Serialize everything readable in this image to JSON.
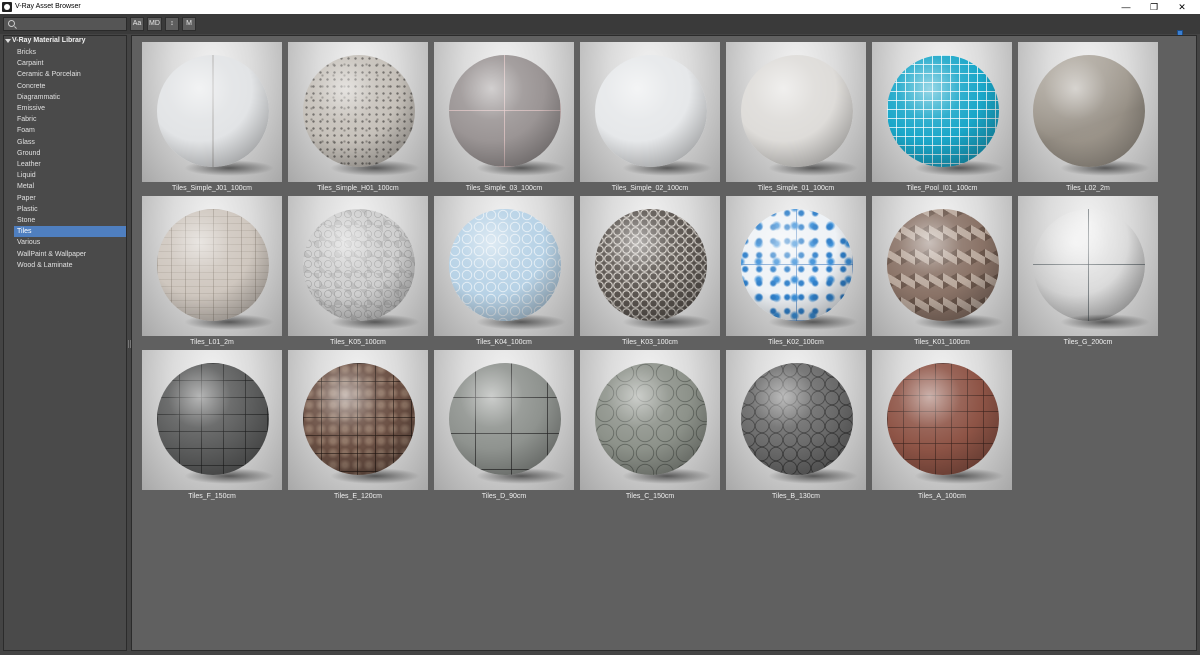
{
  "window": {
    "title": "V-Ray Asset Browser",
    "minimize_glyph": "—",
    "maximize_glyph": "❐",
    "close_glyph": "✕"
  },
  "toolbar": {
    "search_placeholder": "",
    "buttons": {
      "aa": "Aa",
      "md": "MD",
      "sort": "↕",
      "m": "M"
    },
    "thumbnail_size_level": 0.8
  },
  "sidebar": {
    "root": "V-Ray Material Library",
    "items": [
      "Bricks",
      "Carpaint",
      "Ceramic & Porcelain",
      "Concrete",
      "Diagrammatic",
      "Emissive",
      "Fabric",
      "Foam",
      "Glass",
      "Ground",
      "Leather",
      "Liquid",
      "Metal",
      "Paper",
      "Plastic",
      "Stone",
      "Tiles",
      "Various",
      "WallPaint & Wallpaper",
      "Wood & Laminate"
    ],
    "selected": "Tiles"
  },
  "materials": [
    {
      "name": "Tiles_Simple_J01_100cm",
      "icon": "m-split"
    },
    {
      "name": "Tiles_Simple_H01_100cm",
      "icon": "m-terrazzo"
    },
    {
      "name": "Tiles_Simple_03_100cm",
      "icon": "m-grey-grid"
    },
    {
      "name": "Tiles_Simple_02_100cm",
      "icon": "m-plain-white"
    },
    {
      "name": "Tiles_Simple_01_100cm",
      "icon": "m-plain-offwhite"
    },
    {
      "name": "Tiles_Pool_I01_100cm",
      "icon": "m-pool"
    },
    {
      "name": "Tiles_L02_2m",
      "icon": "m-concrete"
    },
    {
      "name": "Tiles_L01_2m",
      "icon": "m-wood-planks"
    },
    {
      "name": "Tiles_K05_100cm",
      "icon": "m-pattern-mix"
    },
    {
      "name": "Tiles_K04_100cm",
      "icon": "m-moroccan-blue"
    },
    {
      "name": "Tiles_K03_100cm",
      "icon": "m-lattice"
    },
    {
      "name": "Tiles_K02_100cm",
      "icon": "m-azulejo"
    },
    {
      "name": "Tiles_K01_100cm",
      "icon": "m-cubes"
    },
    {
      "name": "Tiles_G_200cm",
      "icon": "m-slate"
    },
    {
      "name": "Tiles_F_150cm",
      "icon": "m-dark-pavers"
    },
    {
      "name": "Tiles_E_120cm",
      "icon": "m-brown-pavers"
    },
    {
      "name": "Tiles_D_90cm",
      "icon": "m-interlock-big"
    },
    {
      "name": "Tiles_C_150cm",
      "icon": "m-interlock-med"
    },
    {
      "name": "Tiles_B_130cm",
      "icon": "m-interlock-dark"
    },
    {
      "name": "Tiles_A_100cm",
      "icon": "m-brick-red"
    }
  ]
}
